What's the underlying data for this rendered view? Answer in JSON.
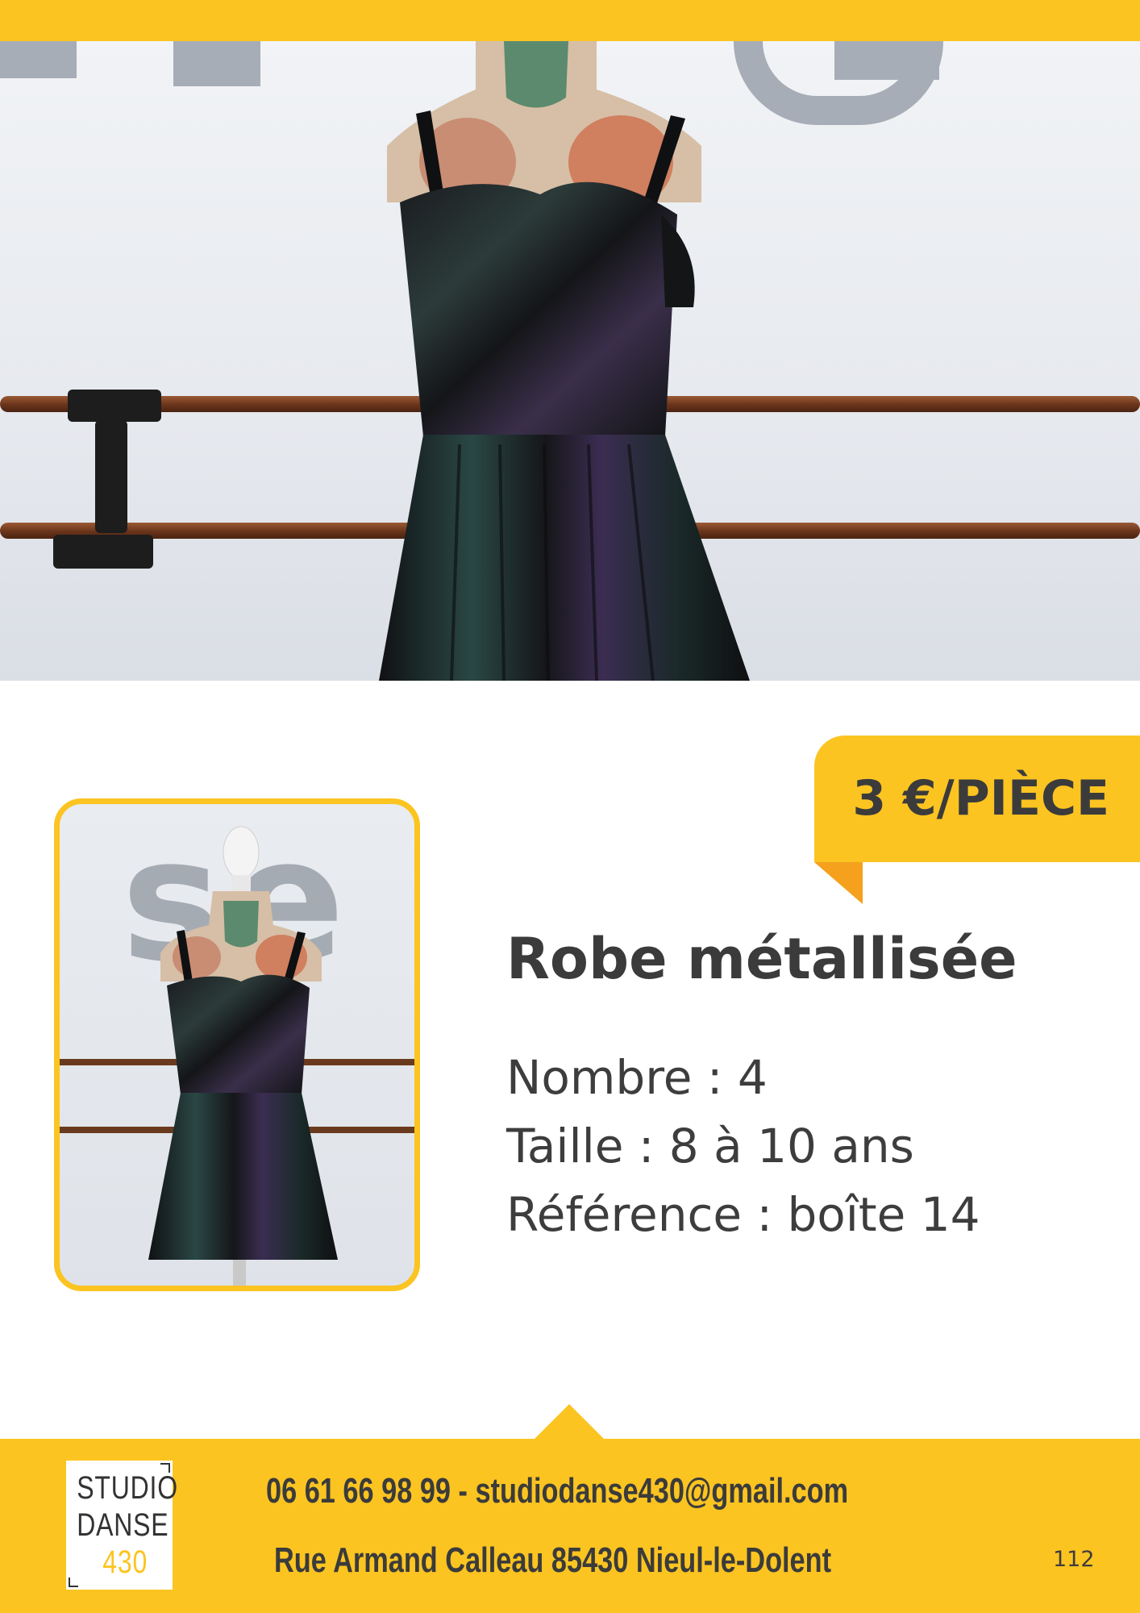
{
  "price": {
    "label": "3 €/PIÈCE"
  },
  "product": {
    "title": "Robe métallisée",
    "count_line": "Nombre : 4",
    "size_line": "Taille : 8 à 10 ans",
    "reference_line": "Référence : boîte 14"
  },
  "footer": {
    "logo_lines": [
      "STUDIO",
      "DANSE",
      "430"
    ],
    "contact_line": "06 61 66 98 99 - studiodanse430@gmail.com",
    "address_line": "Rue Armand Calleau 85430 Nieul-le-Dolent",
    "page_number": "112"
  },
  "thumbnail": {
    "wall_letters": "se"
  },
  "colors": {
    "accent": "#fbc421",
    "accent_dark": "#f5a11e",
    "text": "#3b3b3b"
  }
}
